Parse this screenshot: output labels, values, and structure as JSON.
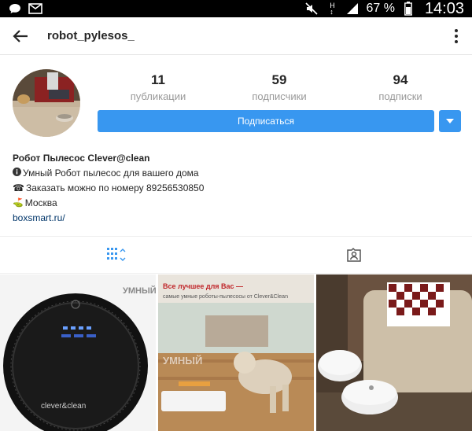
{
  "status_bar": {
    "battery": "67 %",
    "time": "14:03",
    "icons": [
      "chat-icon",
      "mail-icon",
      "mute-icon",
      "signal-icon",
      "battery-icon"
    ]
  },
  "header": {
    "username": "robot_pylesos_"
  },
  "profile": {
    "stats": [
      {
        "value": "11",
        "label": "публикации"
      },
      {
        "value": "59",
        "label": "подписчики"
      },
      {
        "value": "94",
        "label": "подписки"
      }
    ],
    "follow_label": "Подписаться",
    "bio": {
      "name": "Робот Пылесос Clever@clean",
      "line1": "Умный Робот пылесос для вашего дома",
      "line2": "Заказать можно по номеру 89256530850",
      "line3": "Москва",
      "link": "boxsmart.ru/"
    }
  },
  "posts": [
    {
      "brand_text": "clever&clean",
      "watermark": "УМНЫЙ"
    },
    {
      "headline": "Все лучшее для Вас —",
      "subline": "самые умные роботы-пылесосы от Clever&Clean",
      "watermark": "УМНЫЙ"
    },
    {}
  ],
  "colors": {
    "accent": "#3897f0",
    "status_bar": "#000000"
  }
}
